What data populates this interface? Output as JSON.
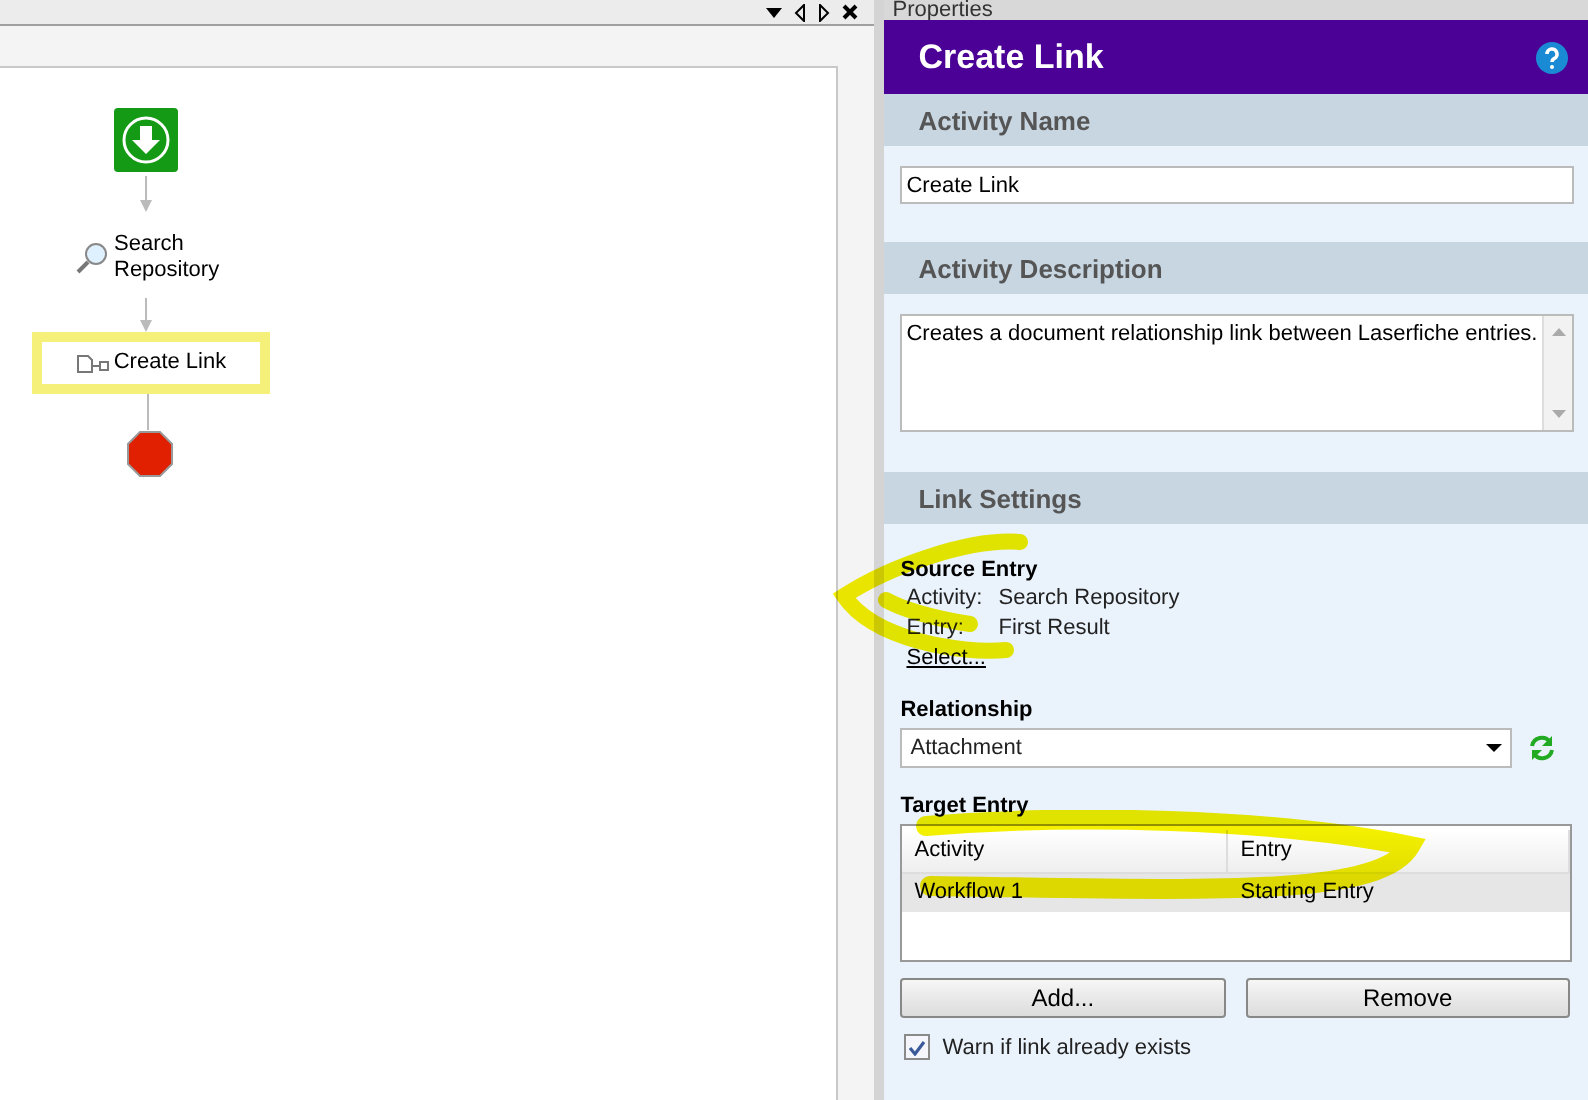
{
  "workflow": {
    "nodes": [
      {
        "kind": "start"
      },
      {
        "kind": "search",
        "label": "Search Repository",
        "selected": false
      },
      {
        "kind": "link",
        "label": "Create Link",
        "selected": true
      },
      {
        "kind": "end"
      }
    ]
  },
  "properties": {
    "pane_title": "Properties",
    "header": "Create Link",
    "activity_name": {
      "heading": "Activity Name",
      "value": "Create Link"
    },
    "activity_description": {
      "heading": "Activity Description",
      "value": "Creates a document relationship link between Laserfiche entries."
    },
    "link_settings": {
      "heading": "Link Settings",
      "source_entry": {
        "heading": "Source Entry",
        "rows": [
          {
            "label": "Activity:",
            "value": "Search Repository"
          },
          {
            "label": "Entry:",
            "value": "First Result"
          }
        ],
        "link": "Select..."
      },
      "relationship": {
        "heading": "Relationship",
        "value": "Attachment"
      },
      "target_entry": {
        "heading": "Target Entry",
        "columns": [
          "Activity",
          "Entry"
        ],
        "rows": [
          {
            "cells": [
              "Workflow 1",
              "Starting Entry"
            ],
            "selected": true
          }
        ]
      },
      "buttons": [
        "Add...",
        "Remove"
      ],
      "warn": {
        "label": "Warn if link already exists",
        "checked": true
      }
    }
  }
}
